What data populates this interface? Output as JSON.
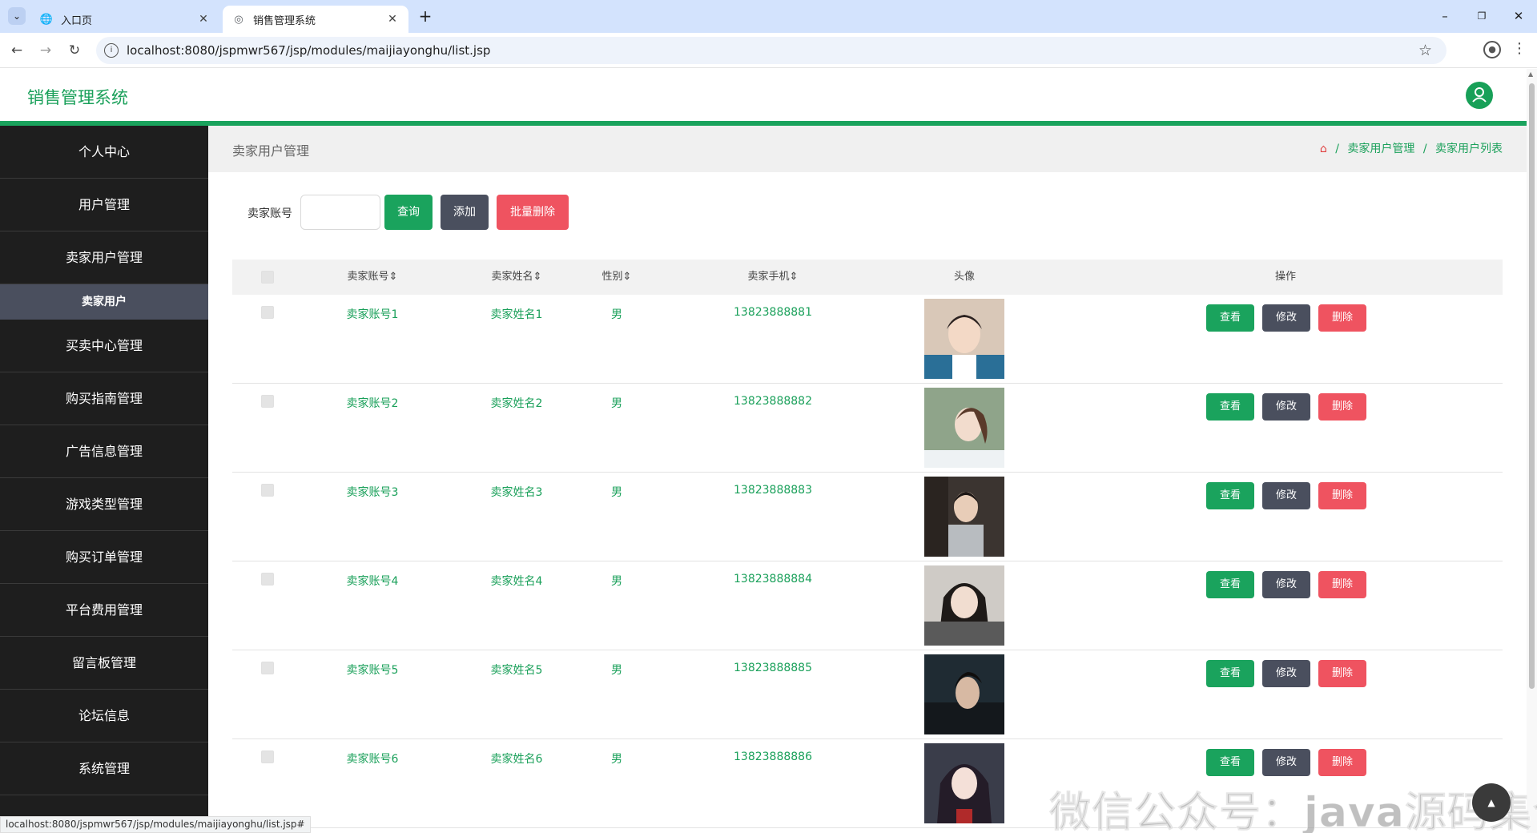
{
  "browser": {
    "tabs": [
      {
        "label": "入口页",
        "icon": "globe-icon"
      },
      {
        "label": "销售管理系统",
        "icon": "page-icon"
      }
    ],
    "url": "localhost:8080/jspmwr567/jsp/modules/maijiayonghu/list.jsp",
    "status_url": "localhost:8080/jspmwr567/jsp/modules/maijiayonghu/list.jsp#"
  },
  "header": {
    "title": "销售管理系统"
  },
  "sidebar": {
    "items": [
      {
        "label": "个人中心"
      },
      {
        "label": "用户管理"
      },
      {
        "label": "卖家用户管理"
      },
      {
        "label": "卖家用户",
        "sub": true
      },
      {
        "label": "买卖中心管理"
      },
      {
        "label": "购买指南管理"
      },
      {
        "label": "广告信息管理"
      },
      {
        "label": "游戏类型管理"
      },
      {
        "label": "购买订单管理"
      },
      {
        "label": "平台费用管理"
      },
      {
        "label": "留言板管理"
      },
      {
        "label": "论坛信息"
      },
      {
        "label": "系统管理"
      }
    ]
  },
  "breadcrumb": {
    "page_title": "卖家用户管理",
    "level1": "卖家用户管理",
    "level2": "卖家用户列表",
    "separator": "/"
  },
  "search": {
    "label": "卖家账号",
    "value": "",
    "query_label": "查询",
    "add_label": "添加",
    "bulk_delete_label": "批量删除"
  },
  "table": {
    "headers": {
      "account": "卖家账号",
      "name": "卖家姓名",
      "gender": "性别",
      "phone": "卖家手机",
      "avatar": "头像",
      "actions": "操作"
    },
    "sort_glyph": "⇕",
    "actions": {
      "view": "查看",
      "edit": "修改",
      "delete": "删除"
    },
    "rows": [
      {
        "account": "卖家账号1",
        "name": "卖家姓名1",
        "gender": "男",
        "phone": "13823888881"
      },
      {
        "account": "卖家账号2",
        "name": "卖家姓名2",
        "gender": "男",
        "phone": "13823888882"
      },
      {
        "account": "卖家账号3",
        "name": "卖家姓名3",
        "gender": "男",
        "phone": "13823888883"
      },
      {
        "account": "卖家账号4",
        "name": "卖家姓名4",
        "gender": "男",
        "phone": "13823888884"
      },
      {
        "account": "卖家账号5",
        "name": "卖家姓名5",
        "gender": "男",
        "phone": "13823888885"
      },
      {
        "account": "卖家账号6",
        "name": "卖家姓名6",
        "gender": "男",
        "phone": "13823888886"
      }
    ]
  },
  "watermark": "微信公众号：java源码集合",
  "colors": {
    "accent": "#1aa35d",
    "sidebar_bg": "#1e1e1e",
    "sub_item_bg": "#4a4f5e",
    "danger": "#ef5360"
  }
}
